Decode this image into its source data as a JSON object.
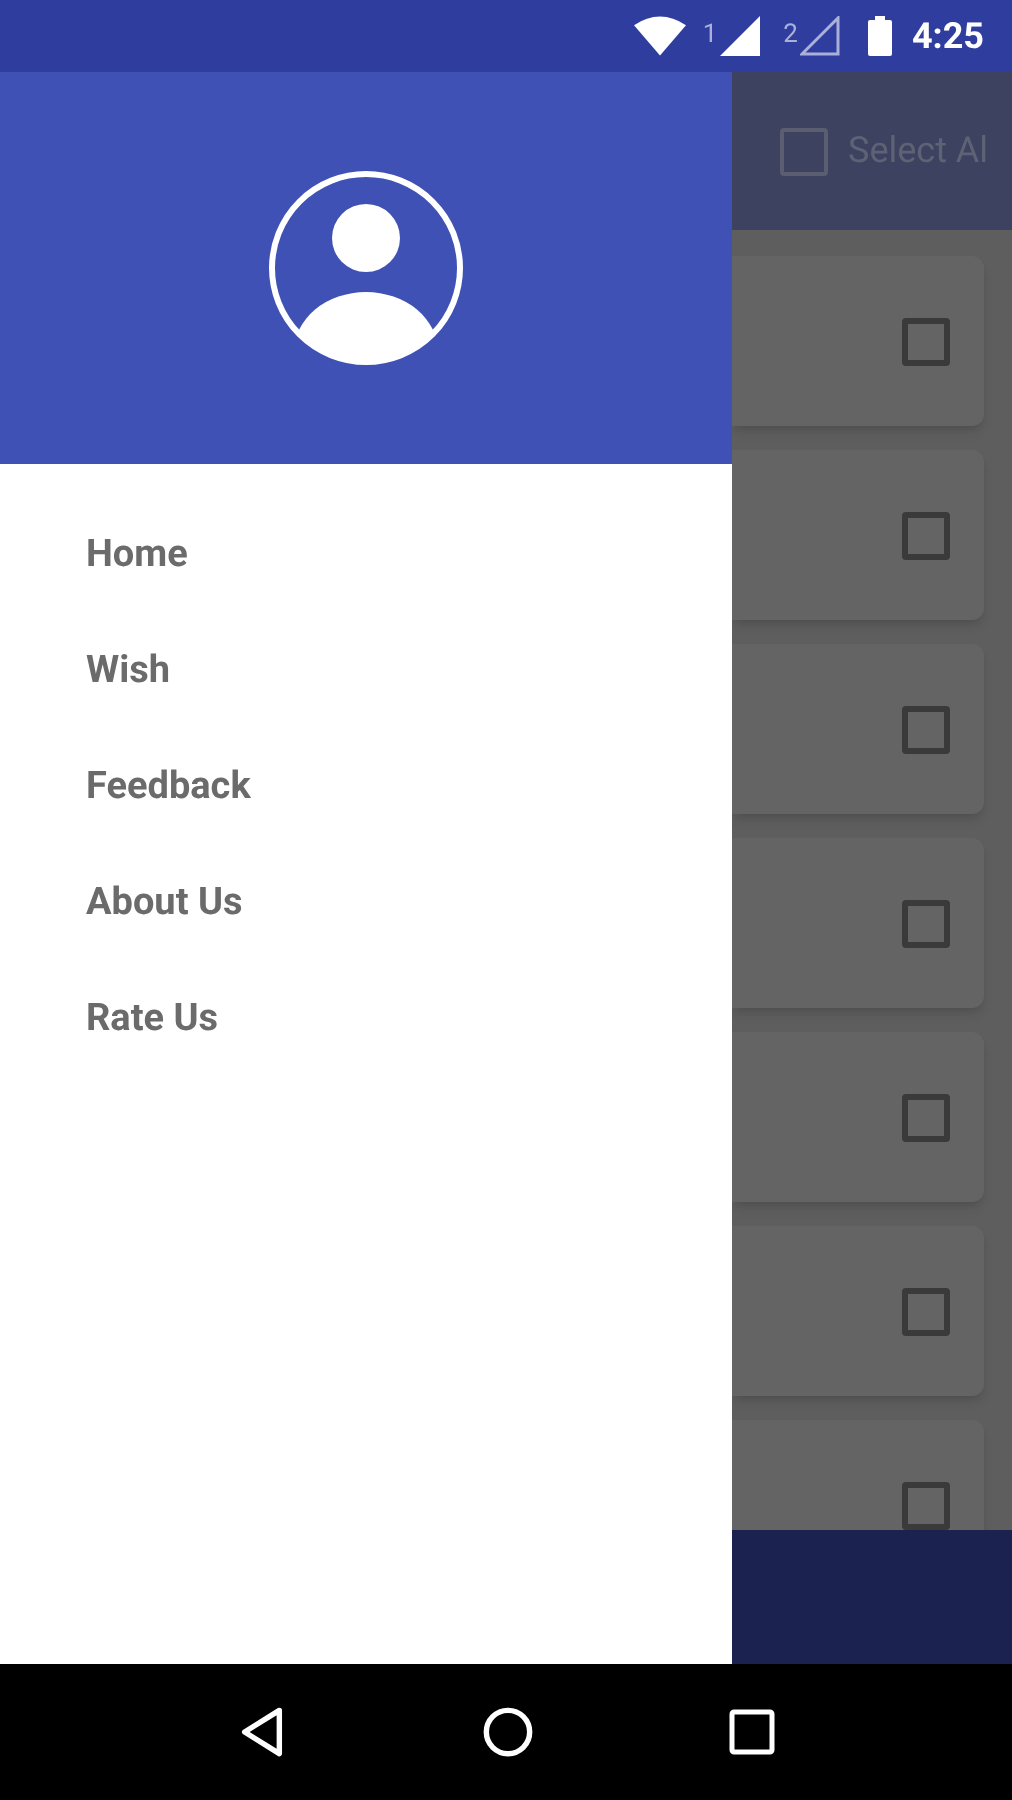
{
  "status_bar": {
    "sim_1": "1",
    "sim_2": "2",
    "time": "4:25"
  },
  "background_app": {
    "select_all": {
      "label": "Select Al",
      "checked": false
    },
    "cards": [
      {
        "checked": false
      },
      {
        "checked": false
      },
      {
        "checked": false
      },
      {
        "checked": false
      },
      {
        "checked": false
      },
      {
        "checked": false
      },
      {
        "checked": false
      }
    ]
  },
  "drawer": {
    "menu_items": [
      "Home",
      "Wish",
      "Feedback",
      "About Us",
      "Rate Us"
    ]
  }
}
